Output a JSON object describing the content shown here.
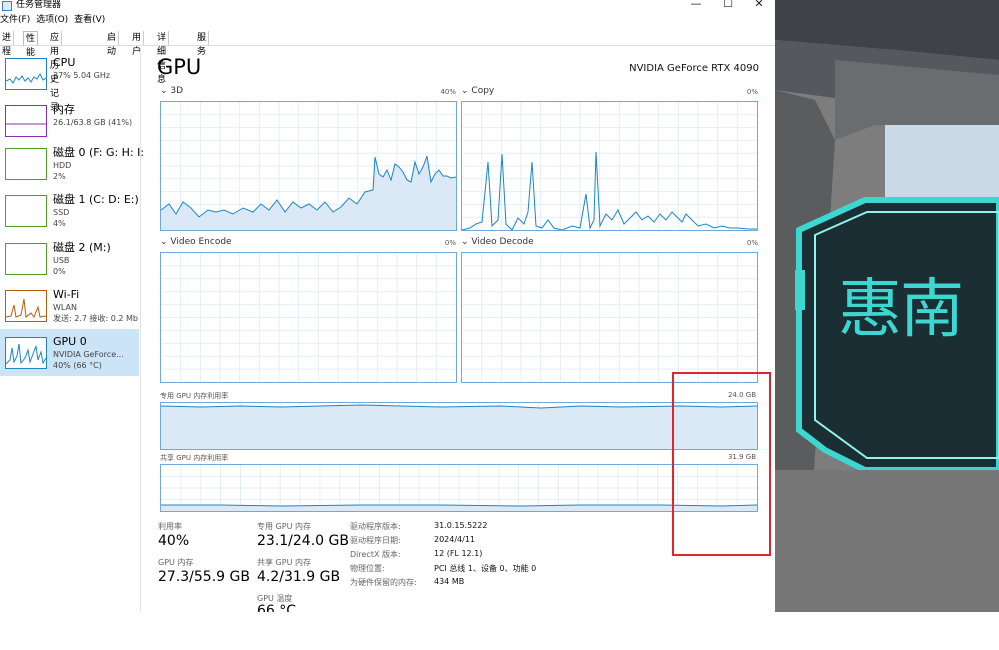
{
  "window": {
    "title": "任务管理器",
    "minimize_glyph": "—",
    "maximize_glyph": "☐",
    "close_glyph": "✕"
  },
  "menu": [
    "文件(F)",
    "选项(O)",
    "查看(V)"
  ],
  "tabs": [
    {
      "label": "进程",
      "active": false
    },
    {
      "label": "性能",
      "active": true
    },
    {
      "label": "应用历史记录",
      "active": false
    },
    {
      "label": "启动",
      "active": false
    },
    {
      "label": "用户",
      "active": false
    },
    {
      "label": "详细信息",
      "active": false
    },
    {
      "label": "服务",
      "active": false
    }
  ],
  "sidebar": [
    {
      "name": "CPU",
      "lines": [
        "37% 5.04 GHz"
      ],
      "color": "#1a85c8",
      "active": false
    },
    {
      "name": "内存",
      "lines": [
        "26.1/63.8 GB (41%)"
      ],
      "color": "#8b2db5",
      "active": false
    },
    {
      "name": "磁盘 0 (F: G: H: I:",
      "lines": [
        "HDD",
        "2%"
      ],
      "color": "#4da31f",
      "active": false
    },
    {
      "name": "磁盘 1 (C: D: E:)",
      "lines": [
        "SSD",
        "4%"
      ],
      "color": "#4da31f",
      "active": false
    },
    {
      "name": "磁盘 2 (M:)",
      "lines": [
        "USB",
        "0%"
      ],
      "color": "#4da31f",
      "active": false
    },
    {
      "name": "Wi-Fi",
      "lines": [
        "WLAN",
        "发送: 2.7  接收: 0.2 Mb"
      ],
      "color": "#b75d0e",
      "active": false
    },
    {
      "name": "GPU 0",
      "lines": [
        "NVIDIA GeForce...",
        "40% (66 °C)"
      ],
      "color": "#1a85c8",
      "active": true
    }
  ],
  "gpu": {
    "title": "GPU",
    "model": "NVIDIA GeForce RTX 4090",
    "engines": [
      {
        "name": "3D",
        "percent": "40%"
      },
      {
        "name": "Copy",
        "percent": "0%"
      },
      {
        "name": "Video Encode",
        "percent": "0%"
      },
      {
        "name": "Video Decode",
        "percent": "0%"
      }
    ],
    "dedicated_label": "专用 GPU 内存利用率",
    "dedicated_max": "24.0 GB",
    "shared_label": "共享 GPU 内存利用率",
    "shared_max": "31.9 GB"
  },
  "stats": {
    "utilization_label": "利用率",
    "utilization": "40%",
    "dedicated_label": "专用 GPU 内存",
    "dedicated": "23.1/24.0 GB",
    "gpu_mem_label": "GPU 内存",
    "gpu_mem": "27.3/55.9 GB",
    "shared_label": "共享 GPU 内存",
    "shared": "4.2/31.9 GB",
    "temp_label": "GPU 温度",
    "temp_partial": "66 °C"
  },
  "info": [
    {
      "key": "驱动程序版本:",
      "value": "31.0.15.5222"
    },
    {
      "key": "驱动程序日期:",
      "value": "2024/4/11"
    },
    {
      "key": "DirectX 版本:",
      "value": "12 (FL 12.1)"
    },
    {
      "key": "物理位置:",
      "value": "PCI 总线 1、设备 0、功能 0"
    },
    {
      "key": "为硬件保留的内存:",
      "value": "434 MB"
    }
  ],
  "scene": {
    "sign_text": "惠南"
  },
  "colors": {
    "accent": "#1a85c8",
    "graph_border": "#6fa8dc",
    "highlight": "#e0262a",
    "sign": "#3cd7d0"
  }
}
